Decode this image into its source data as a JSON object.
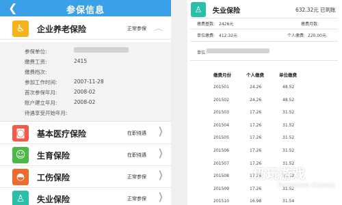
{
  "left": {
    "title": "参保信息",
    "expanded": {
      "name": "企业养老保险",
      "status": "正常参保",
      "fields": [
        {
          "label": "参保单位:",
          "value": ""
        },
        {
          "label": "缴费工资:",
          "value": "2415"
        },
        {
          "label": "缴费档次:",
          "value": ""
        },
        {
          "label": "参加工作时间:",
          "value": "2007-11-28"
        },
        {
          "label": "首次参保年月:",
          "value": "2008-02"
        },
        {
          "label": "账户建立年月:",
          "value": "2008-02"
        },
        {
          "label": "待遇享受开始年月:",
          "value": ""
        }
      ]
    },
    "items": [
      {
        "name": "基本医疗保险",
        "status": "在职待遇",
        "color": "#f25a4a",
        "icon": "camera-icon"
      },
      {
        "name": "生育保险",
        "status": "在职待遇",
        "color": "#4cb848",
        "icon": "baby-icon"
      },
      {
        "name": "工伤保险",
        "status": "正常参保",
        "color": "#ef6b2c",
        "icon": "helmet-icon"
      },
      {
        "name": "失业保险",
        "status": "正常参保",
        "color": "#2bbfa8",
        "icon": "person-icon"
      }
    ],
    "colors": {
      "accent": "#3aa0e8",
      "pension": "#f5b21b"
    }
  },
  "right": {
    "title": "失业保险",
    "amount": "632.32元 已到账",
    "summary": {
      "base_label": "缴费基数:",
      "base_value": "2426元",
      "months_label": "缴费月数:",
      "months_value": "",
      "unit_fee_label": "单位缴费:",
      "unit_fee_value": "412.32元",
      "personal_fee_label": "个人缴费:",
      "personal_fee_value": "220.00元"
    },
    "unit_label": "单位:",
    "table": {
      "headers": [
        "缴费月份",
        "个人缴费",
        "单位缴费"
      ],
      "rows": [
        [
          "201501",
          "24.26",
          "48.52"
        ],
        [
          "201502",
          "24.26",
          "48.52"
        ],
        [
          "201503",
          "17.26",
          "31.52"
        ],
        [
          "201504",
          "17.26",
          "31.52"
        ],
        [
          "201505",
          "17.26",
          "31.52"
        ],
        [
          "201506",
          "17.26",
          "31.52"
        ],
        [
          "201507",
          "17.26",
          "31.52"
        ],
        [
          "201508",
          "17.26",
          "31.52"
        ],
        [
          "201509",
          "17.26",
          "31.52"
        ],
        [
          "201510",
          "16.98",
          "31.54"
        ]
      ]
    }
  },
  "watermark": {
    "main": "仍玩游戏",
    "sub": "Rengwan Games"
  }
}
